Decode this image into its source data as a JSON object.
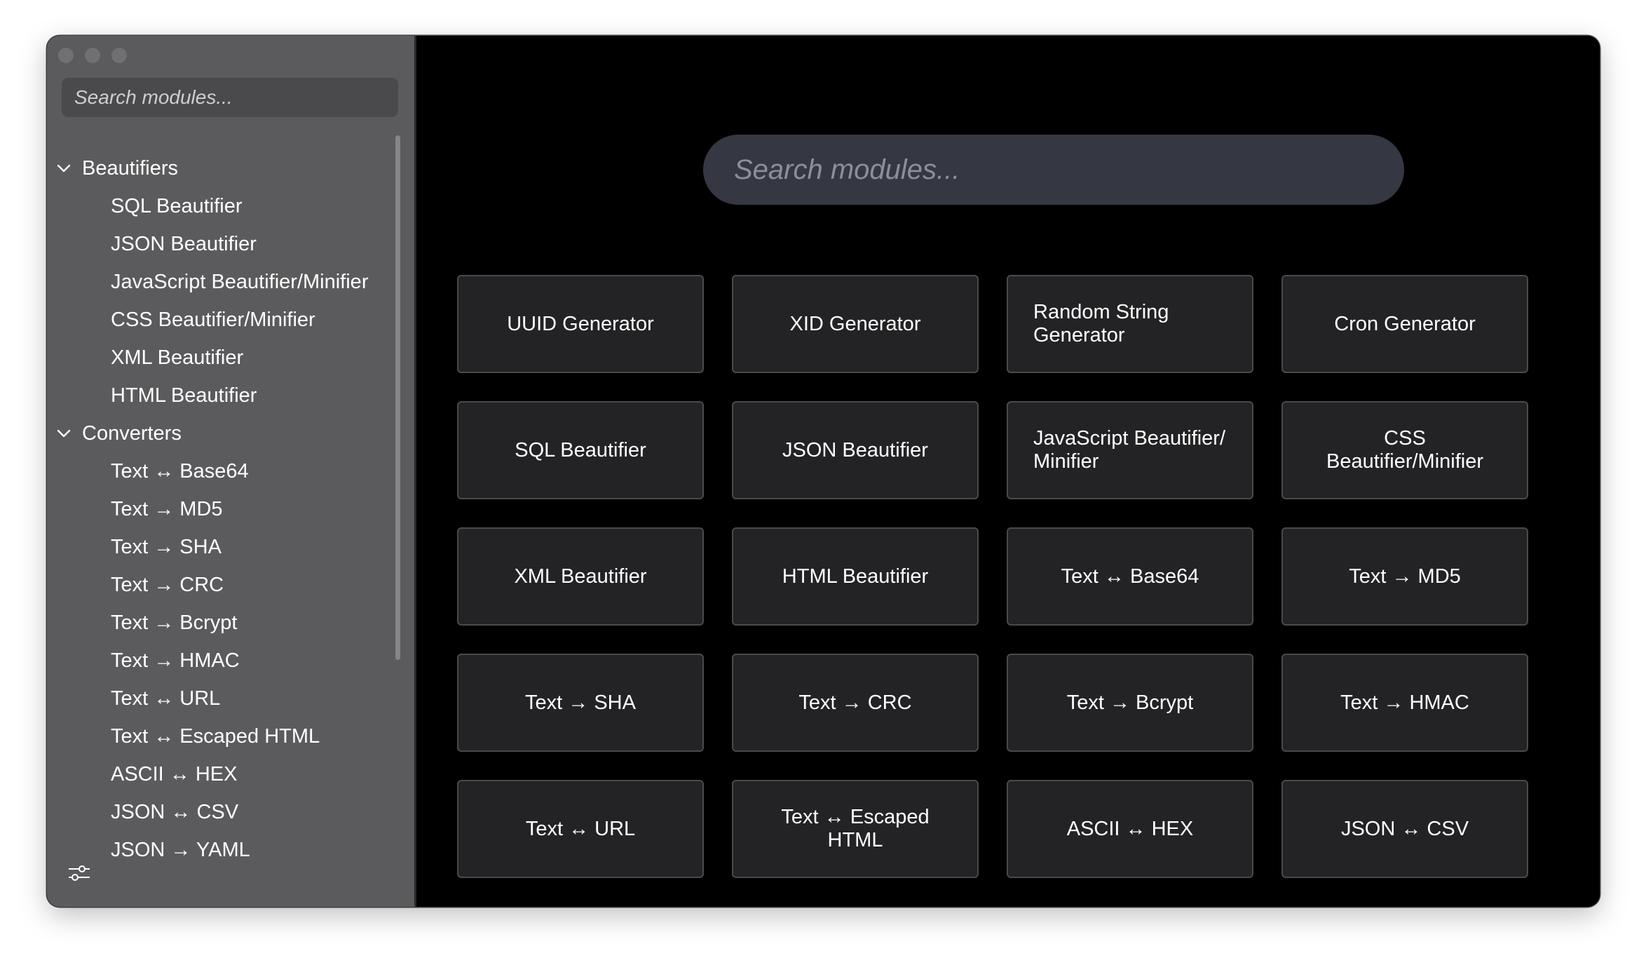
{
  "sidebar": {
    "search_placeholder": "Search modules...",
    "groups": [
      {
        "label": "Beautifiers",
        "items": [
          "SQL Beautifier",
          "JSON Beautifier",
          "JavaScript Beautifier/Minifier",
          "CSS Beautifier/Minifier",
          "XML Beautifier",
          "HTML Beautifier"
        ]
      },
      {
        "label": "Converters",
        "items": [
          "Text ↔ Base64",
          "Text → MD5",
          "Text → SHA",
          "Text → CRC",
          "Text → Bcrypt",
          "Text → HMAC",
          "Text ↔ URL",
          "Text ↔ Escaped HTML",
          "ASCII ↔ HEX",
          "JSON ↔ CSV",
          "JSON → YAML"
        ]
      }
    ],
    "settings_icon": "sliders-icon"
  },
  "main": {
    "search_placeholder": "Search modules...",
    "modules": [
      "UUID Generator",
      "XID Generator",
      "Random String Generator",
      "Cron Generator",
      "SQL Beautifier",
      "JSON Beautifier",
      "JavaScript Beautifier/ Minifier",
      "CSS Beautifier/Minifier",
      "XML Beautifier",
      "HTML Beautifier",
      "Text ↔ Base64",
      "Text → MD5",
      "Text → SHA",
      "Text → CRC",
      "Text → Bcrypt",
      "Text → HMAC",
      "Text ↔ URL",
      "Text ↔ Escaped HTML",
      "ASCII ↔ HEX",
      "JSON ↔ CSV"
    ]
  },
  "colors": {
    "sidebar_bg": "#5b5b5d",
    "main_bg": "#000000",
    "card_bg": "#232325",
    "search_bg": "#353842"
  }
}
